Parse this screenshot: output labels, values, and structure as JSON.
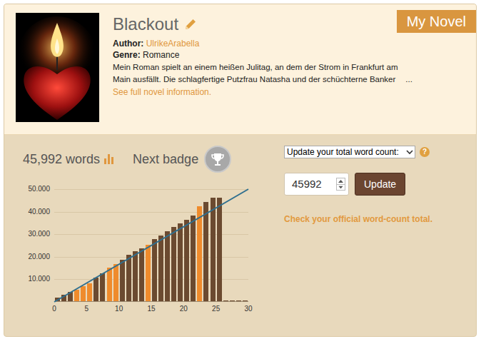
{
  "tab": "My Novel",
  "novel": {
    "title": "Blackout",
    "author_label": "Author:",
    "author": "UlrikeArabella",
    "genre_label": "Genre:",
    "genre": "Romance",
    "description_lines": [
      "Mein Roman spielt an einem heißen Julitag, an dem der Strom in Frankfurt am",
      "Main ausfällt. Die schlagfertige Putzfrau Natasha und der schüchterne Banker"
    ],
    "ellipsis": "...",
    "more_link": "See full novel information."
  },
  "stats": {
    "words": "45,992 words",
    "next_badge": "Next badge"
  },
  "chart": {
    "y_ticks": [
      "50.000",
      "40.000",
      "30.000",
      "20.000",
      "10.000"
    ],
    "x_ticks": [
      "0",
      "5",
      "10",
      "15",
      "20",
      "25",
      "30"
    ],
    "target": [
      0,
      50000
    ],
    "bars": [
      {
        "value": 1500,
        "color": "#6b4a30"
      },
      {
        "value": 3000,
        "color": "#6b4a30"
      },
      {
        "value": 4000,
        "color": "#6b4a30"
      },
      {
        "value": 5200,
        "color": "#ef8b2c"
      },
      {
        "value": 6500,
        "color": "#ef8b2c"
      },
      {
        "value": 8000,
        "color": "#ef8b2c"
      },
      {
        "value": 10500,
        "color": "#6b4a30"
      },
      {
        "value": 12500,
        "color": "#6b4a30"
      },
      {
        "value": 15000,
        "color": "#ef8b2c"
      },
      {
        "value": 16500,
        "color": "#ef8b2c"
      },
      {
        "value": 18500,
        "color": "#6b4a30"
      },
      {
        "value": 20500,
        "color": "#6b4a30"
      },
      {
        "value": 22000,
        "color": "#6b4a30"
      },
      {
        "value": 23500,
        "color": "#6b4a30"
      },
      {
        "value": 25000,
        "color": "#ef8b2c"
      },
      {
        "value": 27500,
        "color": "#6b4a30"
      },
      {
        "value": 29000,
        "color": "#6b4a30"
      },
      {
        "value": 31000,
        "color": "#6b4a30"
      },
      {
        "value": 33000,
        "color": "#6b4a30"
      },
      {
        "value": 34500,
        "color": "#6b4a30"
      },
      {
        "value": 36000,
        "color": "#6b4a30"
      },
      {
        "value": 38000,
        "color": "#6b4a30"
      },
      {
        "value": 42000,
        "color": "#ef8b2c"
      },
      {
        "value": 44000,
        "color": "#6b4a30"
      },
      {
        "value": 45900,
        "color": "#6b4a30"
      },
      {
        "value": 45992,
        "color": "#6b4a30"
      },
      {
        "value": 0,
        "color": "#6b4a30"
      },
      {
        "value": 0,
        "color": "#6b4a30"
      },
      {
        "value": 0,
        "color": "#6b4a30"
      },
      {
        "value": 0,
        "color": "#6b4a30"
      }
    ]
  },
  "update": {
    "select": "Update your total word count:",
    "help": "?",
    "value": "45992",
    "button": "Update",
    "link": "Check your official word-count total."
  }
}
